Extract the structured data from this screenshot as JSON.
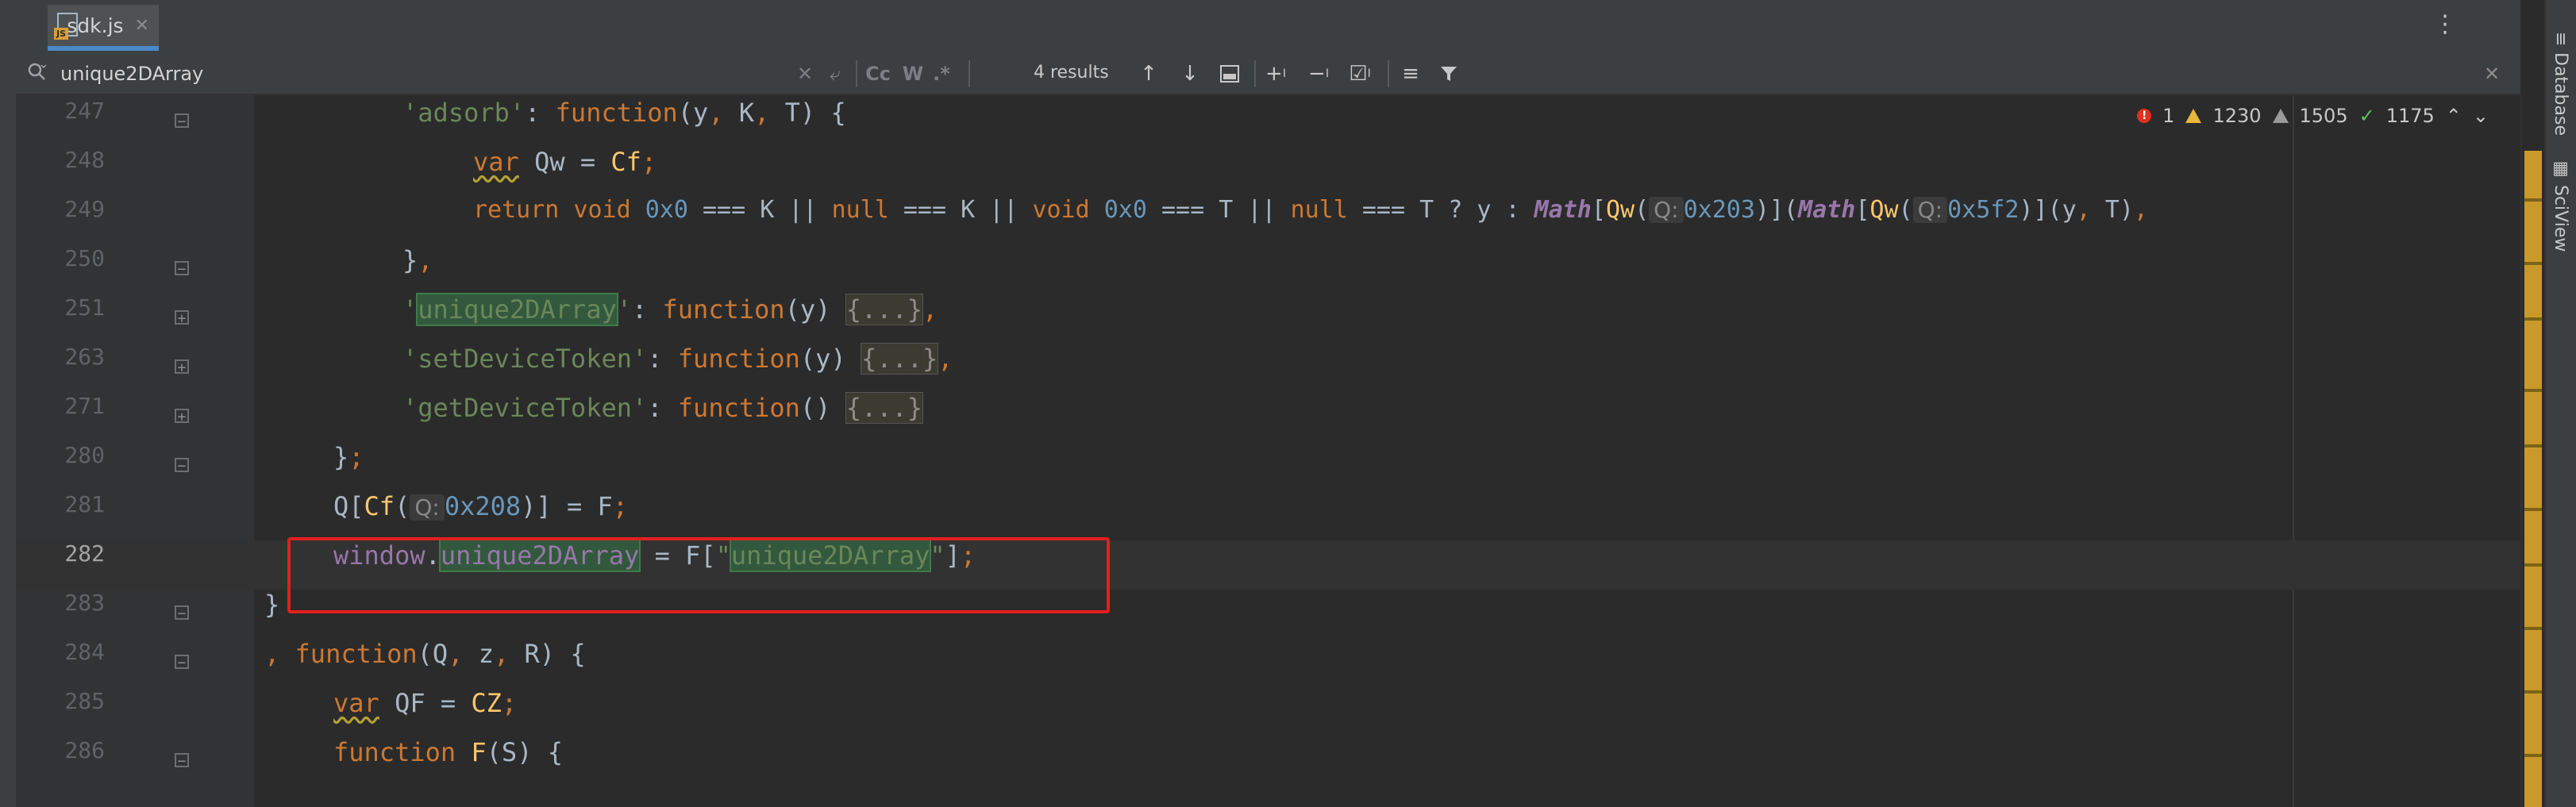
{
  "tab": {
    "icon_badge": "JS",
    "label": "sdk.js",
    "close_icon": "close-icon"
  },
  "tab_menu_icon": "more-vertical-icon",
  "search": {
    "value": "unique2DArray",
    "placeholder": "",
    "match_case": "Cc",
    "words": "W",
    "regex": ".*",
    "results": "4 results"
  },
  "lines": [
    {
      "num": "247",
      "fold": "open"
    },
    {
      "num": "248",
      "fold": "none"
    },
    {
      "num": "249",
      "fold": "none"
    },
    {
      "num": "250",
      "fold": "close"
    },
    {
      "num": "251",
      "fold": "collapsed"
    },
    {
      "num": "263",
      "fold": "collapsed"
    },
    {
      "num": "271",
      "fold": "collapsed"
    },
    {
      "num": "280",
      "fold": "close"
    },
    {
      "num": "281",
      "fold": "none"
    },
    {
      "num": "282",
      "fold": "none"
    },
    {
      "num": "283",
      "fold": "close"
    },
    {
      "num": "284",
      "fold": "open"
    },
    {
      "num": "285",
      "fold": "none"
    },
    {
      "num": "286",
      "fold": "open"
    }
  ],
  "code": {
    "l247": {
      "s1": "'adsorb'",
      "s2": ": ",
      "s3": "function",
      "s4": "(y",
      "s5": ", ",
      "s6": "K",
      "s7": ", ",
      "s8": "T) {"
    },
    "l248": {
      "s1": "var",
      "s2": " Qw",
      "s3": " = ",
      "s4": "Cf",
      "s5": ";"
    },
    "l249": {
      "s1": "return",
      "s2": " ",
      "s3": "void",
      "s4": " ",
      "s5": "0x0",
      "s6": " === K || ",
      "s7": "null",
      "s8": " === K || ",
      "s9": "void",
      "s10": " ",
      "s11": "0x0",
      "s12": " === T || ",
      "s13": "null",
      "s14": " === T ? y : ",
      "s15": "Math",
      "s16": "[",
      "s17": "Qw",
      "s18": "(",
      "s19": "Q:",
      "s20": "0x203",
      "s21": ")](",
      "s22": "Math",
      "s23": "[",
      "s24": "Qw",
      "s25": "(",
      "s26": "Q:",
      "s27": "0x5f2",
      "s28": ")](y",
      "s29": ", ",
      "s30": "T)",
      "s31": ","
    },
    "l250": {
      "s1": "}",
      "s2": ","
    },
    "l251": {
      "s1": "'",
      "s2": "unique2DArray",
      "s3": "'",
      "s4": ": ",
      "s5": "function",
      "s6": "(y) ",
      "s7": "{...}",
      "s8": ","
    },
    "l263": {
      "s1": "'setDeviceToken'",
      "s2": ": ",
      "s3": "function",
      "s4": "(y) ",
      "s5": "{...}",
      "s6": ","
    },
    "l271": {
      "s1": "'getDeviceToken'",
      "s2": ": ",
      "s3": "function",
      "s4": "() ",
      "s5": "{...}"
    },
    "l280": {
      "s1": "}",
      "s2": ";"
    },
    "l281": {
      "s1": "Q[",
      "s2": "Cf",
      "s3": "(",
      "s4": "Q:",
      "s5": "0x208",
      "s6": ")] = F",
      "s7": ";"
    },
    "l282": {
      "s1": "window",
      "s2": ".",
      "s3": "unique2DArray",
      "s4": " = F[",
      "s5": "\"",
      "s6": "unique2DArray",
      "s7": "\"",
      "s8": "]",
      "s9": ";"
    },
    "l283": {
      "s1": "}"
    },
    "l284": {
      "s1": ", ",
      "s2": "function",
      "s3": "(Q",
      "s4": ", ",
      "s5": "z",
      "s6": ", ",
      "s7": "R) {"
    },
    "l285": {
      "s1": "var",
      "s2": " QF",
      "s3": " = ",
      "s4": "CZ",
      "s5": ";"
    },
    "l286": {
      "s1": "function",
      "s2": " ",
      "s3": "F",
      "s4": "(S) {"
    }
  },
  "inspections": {
    "errors": "1",
    "warnings": "1230",
    "weak_warnings": "1505",
    "ok": "1175"
  },
  "right_tools": [
    "Database",
    "SciView"
  ],
  "colors": {
    "keyword": "#cc7832",
    "function_name": "#ffc66d",
    "string": "#6a8759",
    "number": "#6897bb",
    "global": "#9876aa",
    "highlight": "#32593d",
    "annotation_box": "#e0201f"
  }
}
